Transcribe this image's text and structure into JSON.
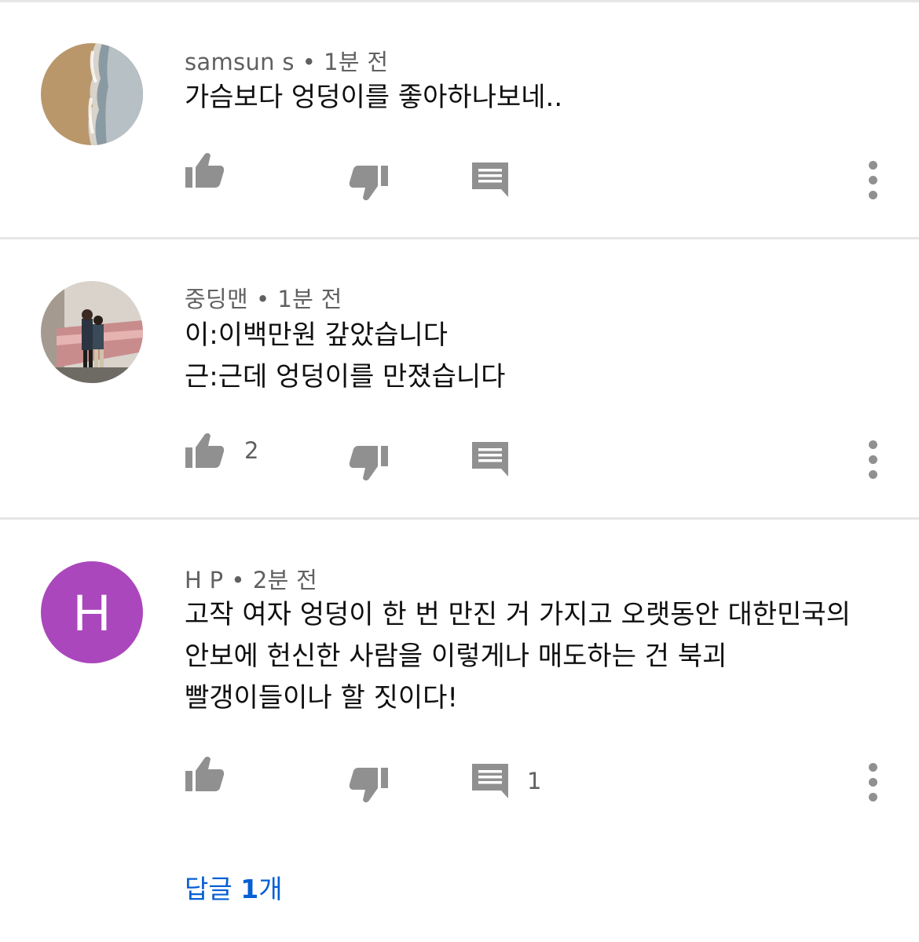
{
  "comments": [
    {
      "author": "samsun s",
      "separator": "•",
      "time": "1분 전",
      "lines": [
        "가슴보다 엉덩이를 좋아하나보네.."
      ],
      "like_count": "",
      "reply_count": ""
    },
    {
      "author": "중딩맨",
      "separator": "•",
      "time": "1분 전",
      "lines": [
        "이:이백만원 갚았습니다",
        "근:근데 엉덩이를 만졌습니다"
      ],
      "like_count": "2",
      "reply_count": ""
    },
    {
      "author": "H P",
      "separator": "•",
      "time": "2분 전",
      "avatar_letter": "H",
      "lines": [
        "고작 여자 엉덩이 한 번 만진 거 가지고 오랫동안 대한민국의",
        "안보에 헌신한 사람을 이렇게나 매도하는 건 북괴",
        "빨갱이들이나 할 짓이다!"
      ],
      "like_count": "",
      "reply_count": "1",
      "replies_label_prefix": "답글 ",
      "replies_label_count": "1",
      "replies_label_suffix": "개"
    }
  ],
  "colors": {
    "icon_gray": "#909090",
    "meta_gray": "#606060",
    "link_blue": "#065fd4",
    "avatar_purple": "#ab47bc"
  },
  "icons": [
    "thumb-up-icon",
    "thumb-down-icon",
    "reply-icon",
    "more-vert-icon"
  ]
}
